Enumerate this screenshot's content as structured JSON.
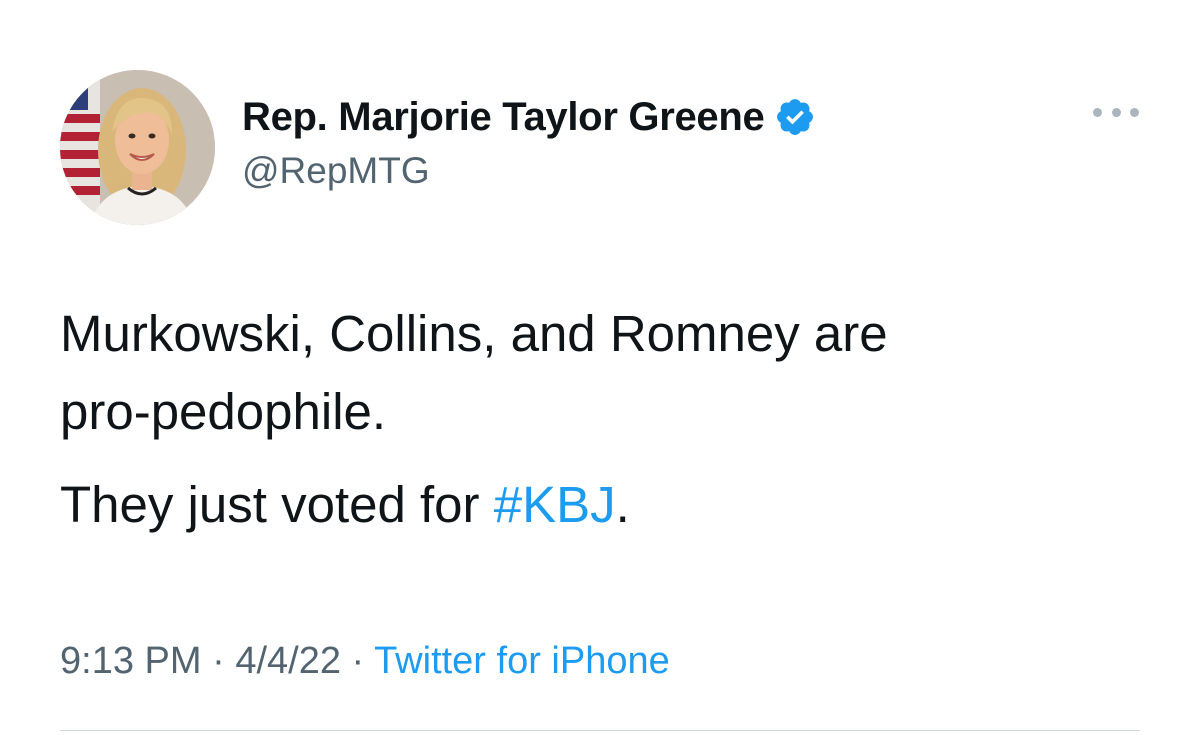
{
  "author": {
    "display_name": "Rep. Marjorie Taylor Greene",
    "handle": "@RepMTG",
    "verified": true,
    "verified_icon": "verified-badge-icon",
    "verified_color": "#1d9bf0"
  },
  "tweet": {
    "line1": "Murkowski, Collins, and Romney are",
    "line2": "pro-pedophile.",
    "para2_prefix": "They just voted for ",
    "hashtag": "#KBJ",
    "para2_suffix": "."
  },
  "meta": {
    "time": "9:13 PM",
    "separator": " · ",
    "date": "4/4/22",
    "source": "Twitter for iPhone"
  },
  "colors": {
    "text": "#0f1419",
    "secondary": "#536471",
    "link": "#1d9bf0"
  },
  "more_icon": "more-horizontal-icon",
  "avatar_icon": "profile-photo"
}
